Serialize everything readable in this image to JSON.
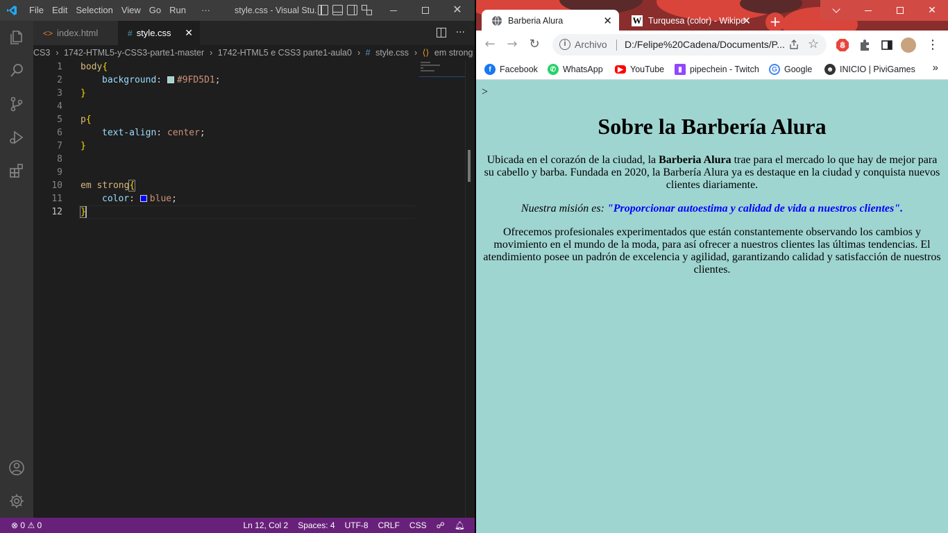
{
  "vscode": {
    "menu": [
      "File",
      "Edit",
      "Selection",
      "View",
      "Go",
      "Run",
      "···"
    ],
    "window_title": "style.css - Visual Stu...",
    "tabs": [
      {
        "icon": "<>",
        "label": "index.html"
      },
      {
        "icon": "#",
        "label": "style.css",
        "close": "✕"
      }
    ],
    "tab_more": "···",
    "breadcrumb": [
      "CS3",
      "1742-HTML5-y-CSS3-parte1-master",
      "1742-HTML5 e CSS3 parte1-aula0",
      "style.css",
      "em strong"
    ],
    "code": {
      "l1_sel": "body",
      "l1_brace": "{",
      "l2_prop": "background",
      "l2_colon": ": ",
      "l2_val": "#9FD5D1",
      "l2_semi": ";",
      "l3_brace": "}",
      "l5_sel": "p",
      "l5_brace": "{",
      "l6_prop": "text-align",
      "l6_colon": ": ",
      "l6_val": "center",
      "l6_semi": ";",
      "l7_brace": "}",
      "l10_sel": "em strong",
      "l10_brace": "{",
      "l11_prop": "color",
      "l11_colon": ": ",
      "l11_val": "blue",
      "l11_semi": ";",
      "l12_brace": "}"
    },
    "line_numbers": [
      "1",
      "2",
      "3",
      "4",
      "5",
      "6",
      "7",
      "8",
      "9",
      "10",
      "11",
      "12"
    ],
    "swatch_colors": {
      "bg": "#9FD5D1",
      "blue": "#0000ff"
    },
    "status": {
      "errors": "0",
      "warnings": "0",
      "position": "Ln 12, Col 2",
      "spaces": "Spaces: 4",
      "encoding": "UTF-8",
      "eol": "CRLF",
      "language": "CSS"
    },
    "colors": {
      "statusbar": "#68217a",
      "activitybar": "#333333",
      "editor": "#1e1e1e"
    }
  },
  "chrome": {
    "tabs": [
      {
        "title": "Barberia Alura",
        "icon": "globe-icon"
      },
      {
        "title": "Turquesa (color) - Wikipe",
        "icon": "wikipedia-icon"
      }
    ],
    "omnibox": {
      "label": "Archivo",
      "url": "D:/Felipe%20Cadena/Documents/P..."
    },
    "bookmarks": [
      {
        "label": "Facebook",
        "icon": "facebook-icon",
        "color": "#1877f2"
      },
      {
        "label": "WhatsApp",
        "icon": "whatsapp-icon",
        "color": "#25d366"
      },
      {
        "label": "YouTube",
        "icon": "youtube-icon",
        "color": "#ff0000"
      },
      {
        "label": "pipechein - Twitch",
        "icon": "twitch-icon",
        "color": "#9146ff"
      },
      {
        "label": "Google",
        "icon": "google-icon",
        "color": "#4285f4"
      },
      {
        "label": "INICIO | PiviGames",
        "icon": "pivigames-icon",
        "color": "#333333"
      }
    ],
    "bookmarks_more": "»"
  },
  "page": {
    "stray": ">",
    "heading": "Sobre la Barbería Alura",
    "p1_before": "Ubicada en el corazón de la ciudad, la ",
    "p1_bold": "Barberia Alura",
    "p1_after": " trae para el mercado lo que hay de mejor para su cabello y barba. Fundada en 2020, la Barbería Alura ya es destaque en la ciudad y conquista nuevos clientes diariamente.",
    "p2_em": "Nuestra misión es: ",
    "p2_strong": "\"Proporcionar autoestima y calidad de vida a nuestros clientes\".",
    "p3": "Ofrecemos profesionales experimentados que están constantemente observando los cambios y movimiento en el mundo de la moda, para así ofrecer a nuestros clientes las últimas tendencias. El atendimiento posee un padrón de excelencia y agilidad, garantizando calidad y satisfacción de nuestros clientes.",
    "background": "#9fd5d1"
  }
}
